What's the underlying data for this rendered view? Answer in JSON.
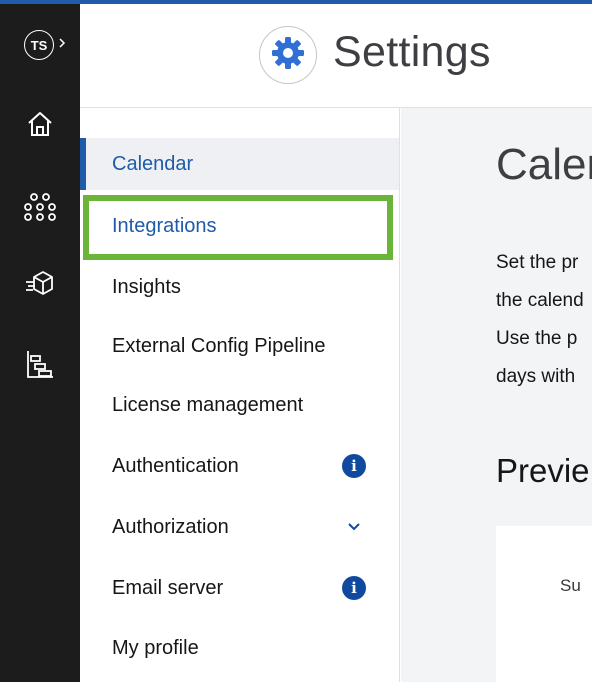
{
  "rail": {
    "avatar_initials": "TS",
    "icons": [
      "chevron-right-icon",
      "home-icon",
      "apps-grid-icon",
      "deploy-box-icon",
      "gantt-chart-icon"
    ]
  },
  "header": {
    "title": "Settings",
    "icon": "gear-icon"
  },
  "menu": {
    "items": [
      {
        "label": "Calendar",
        "state": "active"
      },
      {
        "label": "Integrations",
        "state": "highlighted"
      },
      {
        "label": "Insights"
      },
      {
        "label": "External Config Pipeline"
      },
      {
        "label": "License management"
      },
      {
        "label": "Authentication",
        "badge": "i"
      },
      {
        "label": "Authorization",
        "icon": "chevron-down-icon"
      },
      {
        "label": "Email server",
        "badge": "i"
      },
      {
        "label": "My profile"
      }
    ]
  },
  "content": {
    "title": "Calen",
    "description_lines": [
      "Set the pr",
      "the calend",
      "Use the p",
      "days with"
    ],
    "preview_title": "Previe",
    "day_header": "Su"
  },
  "colors": {
    "accent": "#1f5ba8",
    "rail_bg": "#1c1c1c",
    "highlight_outline": "#6bb43a",
    "info_badge": "#0f4a9e"
  }
}
